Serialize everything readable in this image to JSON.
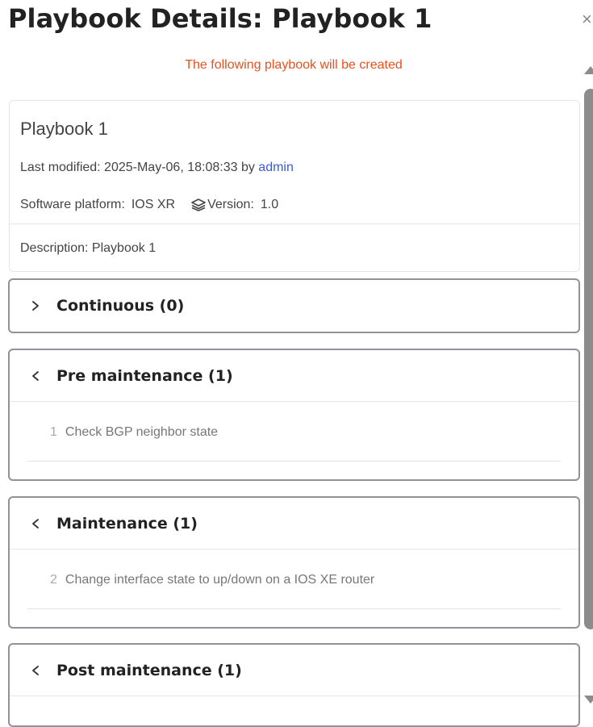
{
  "dialog": {
    "title": "Playbook Details: Playbook 1",
    "close_label": "×",
    "notice": "The following playbook will be created"
  },
  "playbook": {
    "name": "Playbook 1",
    "modified_prefix": "Last modified: 2025-May-06, 18:08:33 by ",
    "modified_user": "admin",
    "platform_label": "Software platform:",
    "platform_value": "IOS XR",
    "version_label": "Version:",
    "version_value": "1.0",
    "description": "Description: Playbook 1"
  },
  "sections": [
    {
      "title": "Continuous (0)",
      "expanded": false,
      "tasks": []
    },
    {
      "title": "Pre maintenance (1)",
      "expanded": true,
      "tasks": [
        {
          "num": "1",
          "label": "Check BGP neighbor state"
        }
      ]
    },
    {
      "title": "Maintenance (1)",
      "expanded": true,
      "tasks": [
        {
          "num": "2",
          "label": "Change interface state to up/down on a IOS XE router"
        }
      ]
    },
    {
      "title": "Post maintenance (1)",
      "expanded": true,
      "tasks": []
    }
  ],
  "colors": {
    "notice": "#e8501e",
    "link": "#3b5bd6",
    "section_border": "#8f929a",
    "scrollbar": "#8c8c8c"
  }
}
